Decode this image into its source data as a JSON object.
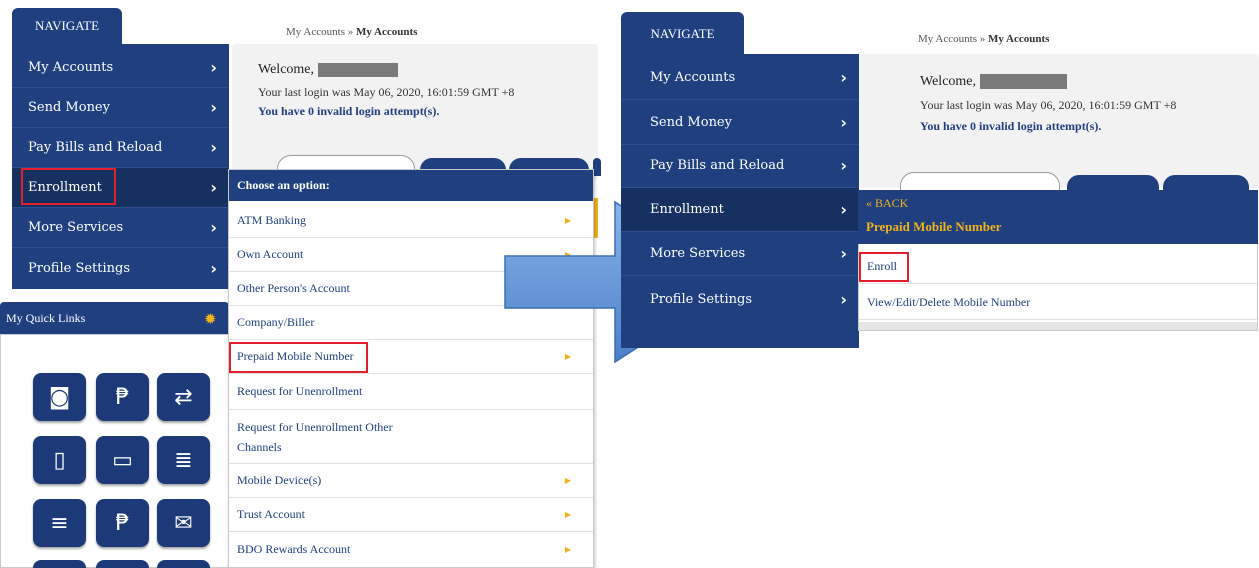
{
  "left": {
    "nav_tab": "NAVIGATE",
    "nav_items": [
      {
        "label": "My Accounts"
      },
      {
        "label": "Send Money"
      },
      {
        "label": "Pay Bills and Reload"
      },
      {
        "label": "Enrollment"
      },
      {
        "label": "More Services"
      },
      {
        "label": "Profile Settings"
      }
    ],
    "breadcrumb_prefix": "My Accounts »",
    "breadcrumb_current": "My Accounts",
    "welcome": "Welcome,",
    "last_login": "Your last login was May 06, 2020, 16:01:59 GMT +8",
    "attempts": "You have 0 invalid login attempt(s).",
    "quick_links_title": "My Quick Links",
    "dropdown": {
      "header": "Choose an option:",
      "items": [
        {
          "label": "ATM Banking"
        },
        {
          "label": "Own Account"
        },
        {
          "label": "Other Person's Account"
        },
        {
          "label": "Company/Biller"
        },
        {
          "label": "Prepaid Mobile Number"
        },
        {
          "label": "Request for Unenrollment"
        },
        {
          "label": "Request for Unenrollment Other Channels"
        },
        {
          "label": "Mobile Device(s)"
        },
        {
          "label": "Trust Account"
        },
        {
          "label": "BDO Rewards Account"
        }
      ]
    }
  },
  "right": {
    "nav_tab": "NAVIGATE",
    "nav_items": [
      {
        "label": "My Accounts"
      },
      {
        "label": "Send Money"
      },
      {
        "label": "Pay Bills and Reload"
      },
      {
        "label": "Enrollment"
      },
      {
        "label": "More Services"
      },
      {
        "label": "Profile Settings"
      }
    ],
    "breadcrumb_prefix": "My Accounts »",
    "breadcrumb_current": "My Accounts",
    "welcome": "Welcome,",
    "last_login": "Your last login was May 06, 2020, 16:01:59 GMT +8",
    "attempts": "You have 0 invalid login attempt(s).",
    "submenu": {
      "back": "« BACK",
      "title": "Prepaid Mobile Number",
      "items": [
        {
          "label": "Enroll"
        },
        {
          "label": "View/Edit/Delete Mobile Number"
        }
      ]
    }
  },
  "colors": {
    "navy": "#1f3f7f",
    "accent": "#f2b21b",
    "highlight": "#e0202a",
    "arrow": "#5b8fd6"
  },
  "icons": {
    "chevron": "›",
    "gear": "✹",
    "triangle": "▶"
  }
}
